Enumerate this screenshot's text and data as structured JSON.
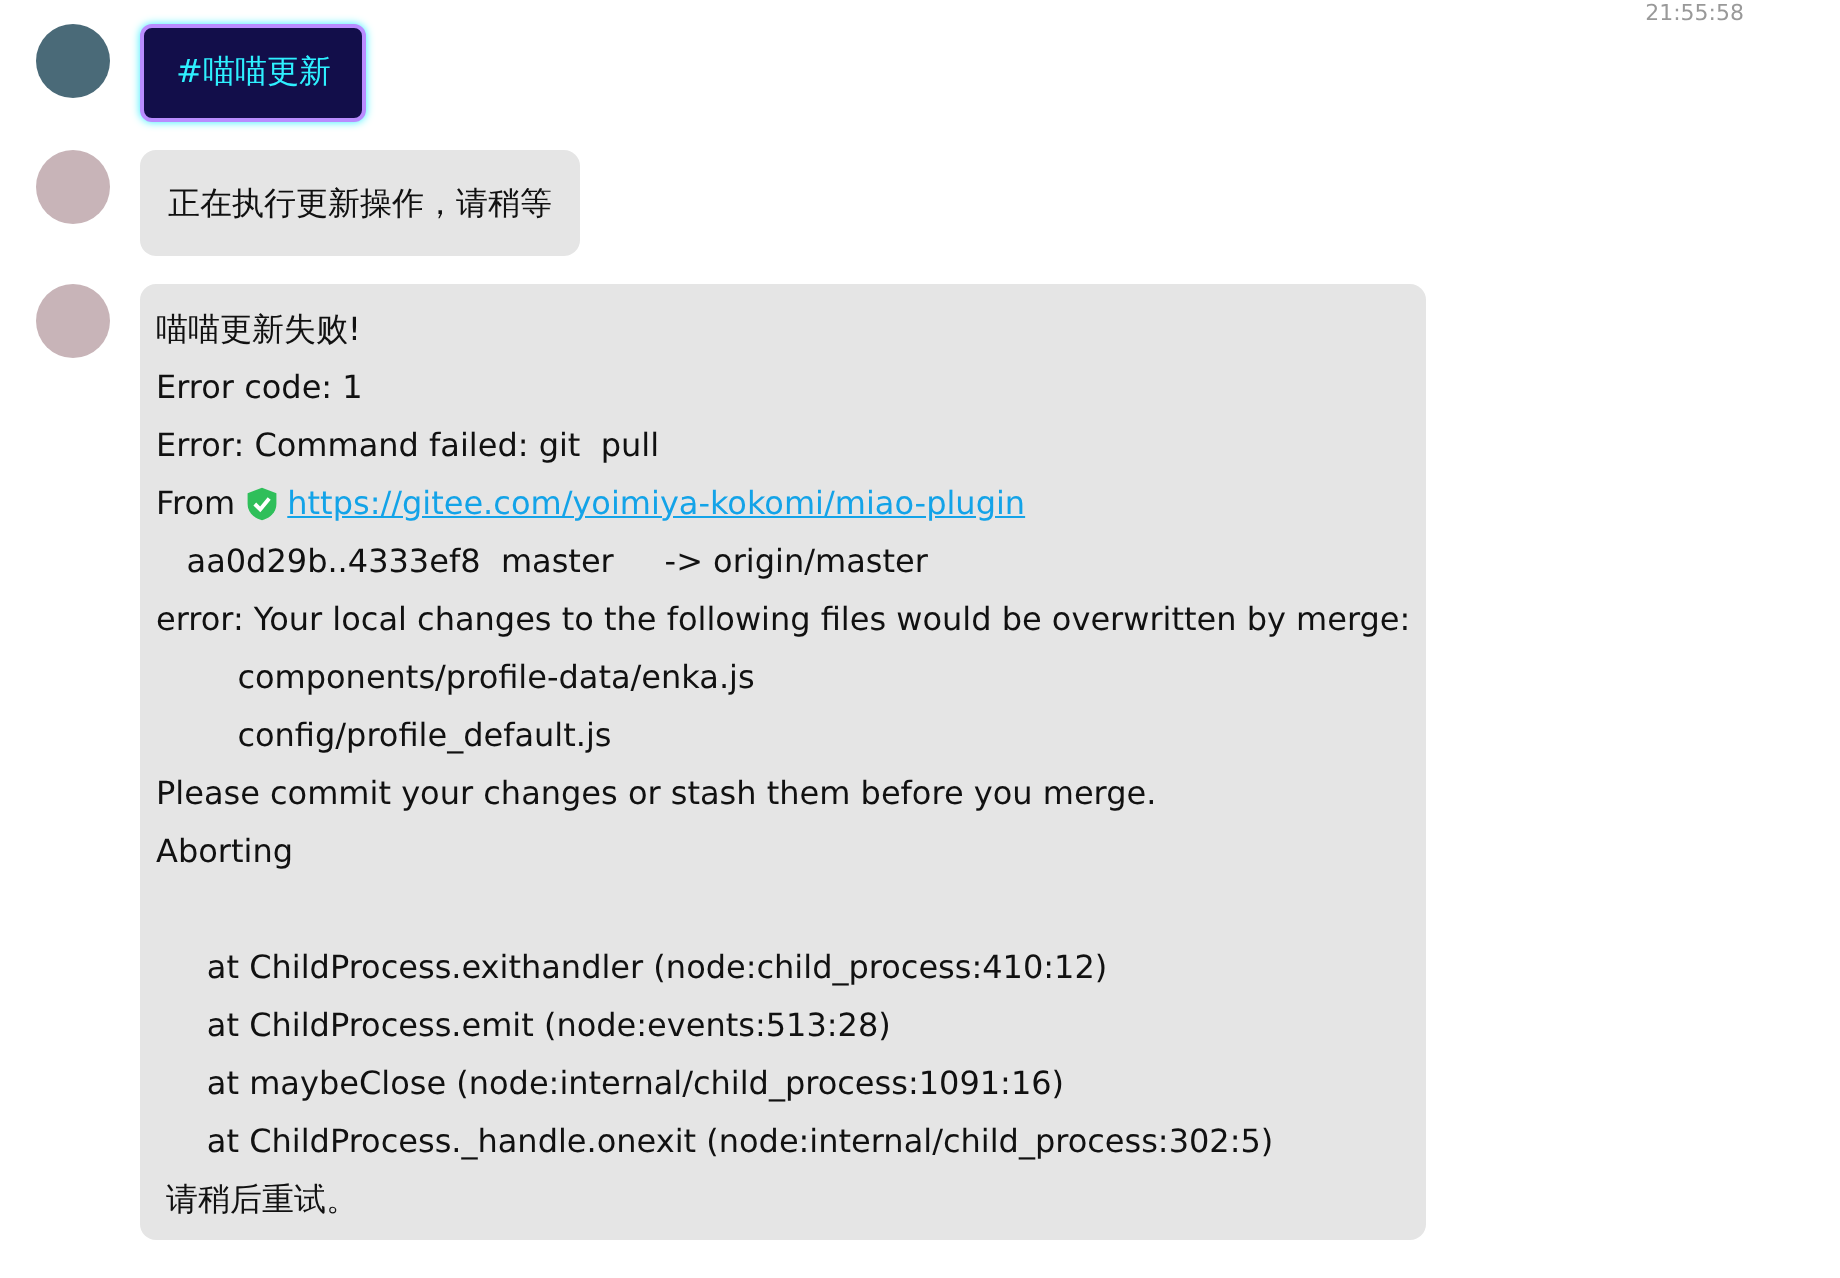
{
  "timestamp": "21:55:58",
  "messages": [
    {
      "kind": "tag",
      "text": "#喵喵更新"
    },
    {
      "kind": "bubble",
      "lines": [
        {
          "kind": "text",
          "text": "正在执行更新操作，请稍等"
        }
      ]
    },
    {
      "kind": "bubble",
      "lines": [
        {
          "kind": "text",
          "text": "喵喵更新失败!"
        },
        {
          "kind": "text",
          "text": "Error code: 1"
        },
        {
          "kind": "text",
          "text": "Error: Command failed: git  pull"
        },
        {
          "kind": "link",
          "prefix": "From",
          "url": "https://gitee.com/yoimiya-kokomi/miao-plugin"
        },
        {
          "kind": "text",
          "text": "   aa0d29b..4333ef8  master     -> origin/master"
        },
        {
          "kind": "text",
          "text": "error: Your local changes to the following files would be overwritten by merge:"
        },
        {
          "kind": "text",
          "text": "        components/profile-data/enka.js"
        },
        {
          "kind": "text",
          "text": "        config/profile_default.js"
        },
        {
          "kind": "text",
          "text": "Please commit your changes or stash them before you merge."
        },
        {
          "kind": "text",
          "text": "Aborting"
        },
        {
          "kind": "blank"
        },
        {
          "kind": "text",
          "text": "     at ChildProcess.exithandler (node:child_process:410:12)"
        },
        {
          "kind": "text",
          "text": "     at ChildProcess.emit (node:events:513:28)"
        },
        {
          "kind": "text",
          "text": "     at maybeClose (node:internal/child_process:1091:16)"
        },
        {
          "kind": "text",
          "text": "     at ChildProcess._handle.onexit (node:internal/child_process:302:5)"
        },
        {
          "kind": "text",
          "text": " 请稍后重试。"
        }
      ]
    }
  ]
}
